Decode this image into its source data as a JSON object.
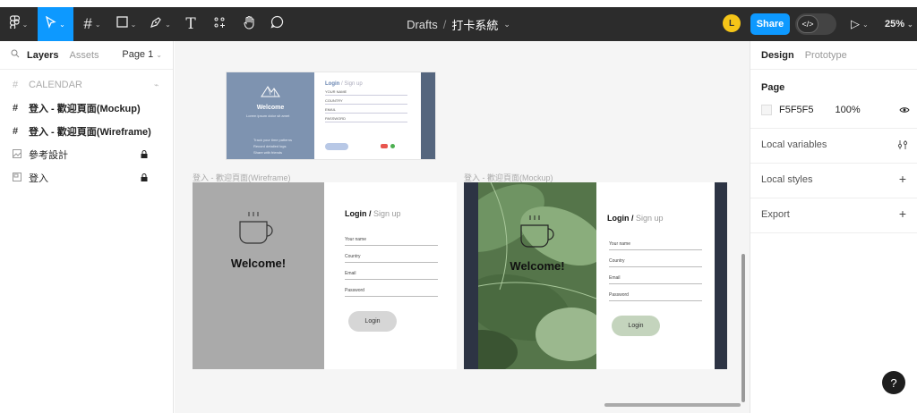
{
  "toolbar": {
    "main_menu_icon": "figma-logo-icon",
    "move_tool_icon": "cursor-icon",
    "frame_tool_icon": "hash-icon",
    "shape_tool_icon": "square-icon",
    "pen_tool_icon": "pen-icon",
    "text_tool_icon": "text-T-icon",
    "resources_icon": "resources-icon",
    "hand_tool_icon": "hand-icon",
    "comment_tool_icon": "comment-icon",
    "breadcrumb_project": "Drafts",
    "breadcrumb_sep": "/",
    "file_name": "打卡系統",
    "avatar_initial": "L",
    "share_label": "Share",
    "dev_mode_glyph": "</>",
    "zoom": "25%",
    "accent": "#0d99ff"
  },
  "left_panel": {
    "tabs": [
      "Layers",
      "Assets"
    ],
    "page_selector": "Page 1",
    "layers": [
      {
        "label": "CALENDAR",
        "icon": "hash-icon",
        "section": true
      },
      {
        "label": "登入 - 歡迎頁面(Mockup)",
        "icon": "hash-icon"
      },
      {
        "label": "登入 - 歡迎頁面(Wireframe)",
        "icon": "hash-icon"
      },
      {
        "label": "參考設計",
        "icon": "image-icon",
        "locked": true
      },
      {
        "label": "登入",
        "icon": "image-icon",
        "locked": true
      }
    ]
  },
  "canvas": {
    "wireframe_label": "登入 - 歡迎頁面(Wireframe)",
    "mockup_label": "登入 - 歡迎頁面(Mockup)",
    "thumb": {
      "welcome": "Welcome",
      "tagline": "Lorem ipsum dolor sit amet",
      "login": "Login",
      "signup": "/ Sign up",
      "fields": [
        "YOUR NAME",
        "COUNTRY",
        "EMAIL",
        "PASSWORD"
      ],
      "bullets": [
        "Track your time patterns",
        "Record detailed logs",
        "Share with friends"
      ]
    },
    "wireframe": {
      "welcome": "Welcome!",
      "login_title": "Login /",
      "signup": "Sign up",
      "fields": [
        "Your name",
        "Country",
        "Email",
        "Password"
      ],
      "button": "Login"
    },
    "mockup": {
      "welcome": "Welcome!",
      "login_title": "Login /",
      "signup": "Sign up",
      "fields": [
        "Your name",
        "Country",
        "Email",
        "Password"
      ],
      "button": "Login",
      "button_color": "#c4d4bd"
    }
  },
  "right_panel": {
    "tabs": [
      "Design",
      "Prototype"
    ],
    "page_heading": "Page",
    "page_color": "F5F5F5",
    "page_opacity": "100%",
    "local_variables": "Local variables",
    "local_styles": "Local styles",
    "export": "Export"
  },
  "help_label": "?"
}
